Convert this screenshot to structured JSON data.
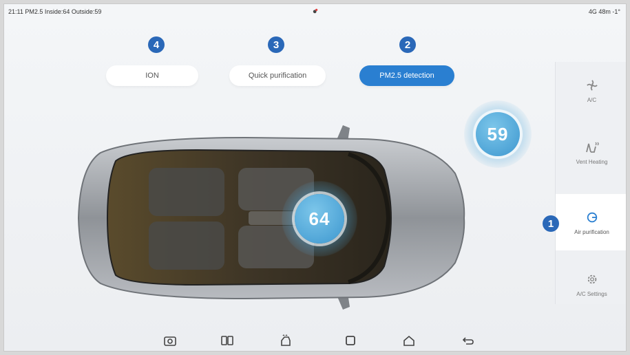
{
  "status": {
    "text": "21:11 PM2.5 Inside:64 Outside:59",
    "right": "4G 48m -1°"
  },
  "modes": [
    {
      "badge": "4",
      "label": "ION",
      "active": false
    },
    {
      "badge": "3",
      "label": "Quick purification",
      "active": false
    },
    {
      "badge": "2",
      "label": "PM2.5 detection",
      "active": true
    }
  ],
  "sidebar": {
    "badge": "1",
    "items": [
      {
        "label": "A/C",
        "icon": "fan-icon"
      },
      {
        "label": "Vent Heating",
        "icon": "seat-heat-icon"
      },
      {
        "label": "Air purification",
        "icon": "air-purify-icon",
        "active": true
      },
      {
        "label": "A/C Settings",
        "icon": "settings-icon"
      }
    ]
  },
  "readings": {
    "inside": "64",
    "outside": "59"
  },
  "colors": {
    "accent": "#2a7fd1",
    "badge": "#2a68b8",
    "bubble": "#4fa9dc"
  },
  "nav_icons": [
    "camera-icon",
    "split-screen-icon",
    "car-wash-icon",
    "square-icon",
    "home-icon",
    "back-icon"
  ]
}
